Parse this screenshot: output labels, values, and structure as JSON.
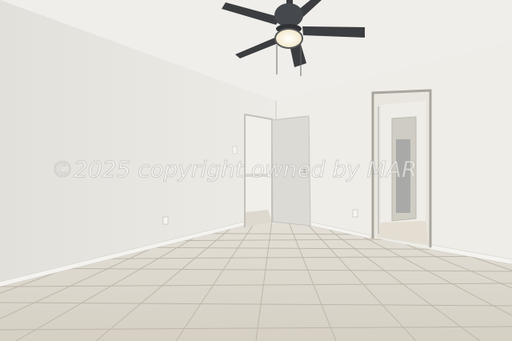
{
  "watermark": {
    "text": "©2025 copyright owned by MAR"
  },
  "palette": {
    "ceiling": "#efeeea",
    "wall_left": "#e7e5df",
    "wall_back": "#eeede8",
    "floor": "#d8d3ca",
    "grout": "#bdb6aa",
    "door": "#dcdad5",
    "door_frame": "#b9b6ae",
    "baseboard": "#f4f3ef",
    "fan_dark": "#3b3d40",
    "fan_light": "#fff6dc"
  }
}
